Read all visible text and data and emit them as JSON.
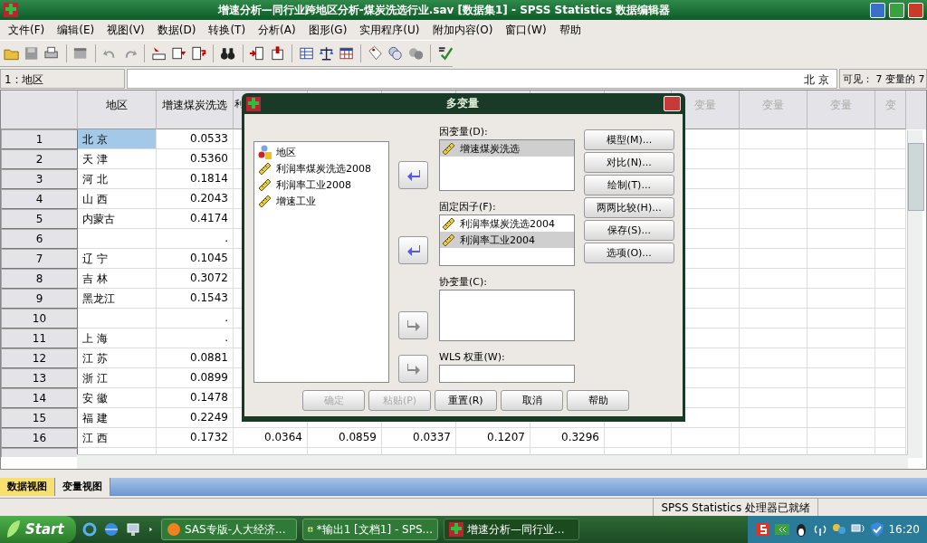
{
  "window": {
    "title": "增速分析—同行业跨地区分析-煤炭洗选行业.sav [数据集1] - SPSS Statistics 数据编辑器"
  },
  "menu": [
    "文件(F)",
    "编辑(E)",
    "视图(V)",
    "数据(D)",
    "转换(T)",
    "分析(A)",
    "图形(G)",
    "实用程序(U)",
    "附加内容(O)",
    "窗口(W)",
    "帮助"
  ],
  "cell_editor": {
    "cell_ref": "1 : 地区",
    "value": "北 京",
    "visible": "可见： 7 变量的 7"
  },
  "columns": [
    {
      "label": "地区",
      "kind": "variable"
    },
    {
      "label": "增速煤炭洗选",
      "kind": "variable"
    },
    {
      "label": "利",
      "kind": "variable"
    },
    {
      "kind": "variable"
    },
    {
      "kind": "variable"
    },
    {
      "kind": "variable"
    },
    {
      "kind": "variable"
    },
    {
      "kind": "empty"
    },
    {
      "label": "变量",
      "kind": "empty"
    },
    {
      "label": "变量",
      "kind": "empty"
    },
    {
      "label": "变量",
      "kind": "empty"
    },
    {
      "label": "变",
      "kind": "empty"
    }
  ],
  "rows": [
    {
      "number": "1",
      "region": "北 京",
      "values": [
        "0.0533"
      ],
      "current": true
    },
    {
      "number": "2",
      "region": "天 津",
      "values": [
        "0.5360"
      ],
      "current": false
    },
    {
      "number": "3",
      "region": "河 北",
      "values": [
        "0.1814"
      ],
      "current": false
    },
    {
      "number": "4",
      "region": "山 西",
      "values": [
        "0.2043"
      ],
      "current": false
    },
    {
      "number": "5",
      "region": "内蒙古",
      "values": [
        "0.4174"
      ],
      "current": false
    },
    {
      "number": "6",
      "values": [
        "."
      ],
      "current": false
    },
    {
      "number": "7",
      "region": "辽 宁",
      "values": [
        "0.1045"
      ],
      "current": false
    },
    {
      "number": "8",
      "region": "吉 林",
      "values": [
        "0.3072"
      ],
      "current": false
    },
    {
      "number": "9",
      "region": "黑龙江",
      "values": [
        "0.1543"
      ],
      "current": false
    },
    {
      "number": "10",
      "values": [
        "."
      ],
      "current": false
    },
    {
      "number": "11",
      "region": "上 海",
      "values": [
        "."
      ],
      "current": false
    },
    {
      "number": "12",
      "region": "江 苏",
      "values": [
        "0.0881"
      ],
      "current": false
    },
    {
      "number": "13",
      "region": "浙 江",
      "values": [
        "0.0899"
      ],
      "current": false
    },
    {
      "number": "14",
      "region": "安 徽",
      "values": [
        "0.1478"
      ],
      "current": false
    },
    {
      "number": "15",
      "region": "福 建",
      "values": [
        "0.2249"
      ],
      "current": false
    },
    {
      "number": "16",
      "region": "江 西",
      "values": [
        "0.1732",
        "0.0364",
        "0.0859",
        "0.0337",
        "0.1207",
        "0.3296"
      ],
      "current": false
    }
  ],
  "dialog": {
    "title": "多变量",
    "source_list": [
      {
        "label": "地区",
        "kind": "nominal"
      },
      {
        "label": "利润率煤炭洗选2008",
        "kind": "scale"
      },
      {
        "label": "利润率工业2008",
        "kind": "scale"
      },
      {
        "label": "增速工业",
        "kind": "scale"
      }
    ],
    "targets": [
      {
        "label": "因变量(D):",
        "kind": "list",
        "disabled": false,
        "items": [
          {
            "label": "增速煤炭洗选",
            "kind": "scale",
            "selected": true
          }
        ]
      },
      {
        "label": "固定因子(F):",
        "kind": "list",
        "disabled": false,
        "items": [
          {
            "label": "利润率煤炭洗选2004",
            "kind": "scale",
            "selected": false
          },
          {
            "label": "利润率工业2004",
            "kind": "scale",
            "selected": true
          }
        ]
      },
      {
        "label": "协变量(C):",
        "kind": "list",
        "disabled": true
      },
      {
        "label": "WLS 权重(W):",
        "kind": "field",
        "disabled": true
      }
    ],
    "side_buttons": [
      "模型(M)...",
      "对比(N)...",
      "绘制(T)...",
      "两两比较(H)...",
      "保存(S)...",
      "选项(O)..."
    ],
    "buttons": [
      {
        "label": "确定",
        "disabled": true
      },
      {
        "label": "粘贴(P)",
        "disabled": true
      },
      {
        "label": "重置(R)",
        "disabled": false
      },
      {
        "label": "取消",
        "disabled": false
      },
      {
        "label": "帮助",
        "disabled": false
      }
    ]
  },
  "view_tabs": [
    {
      "label": "数据视图",
      "selected": true
    },
    {
      "label": "变量视图",
      "selected": false
    }
  ],
  "status_bar": {
    "text": "SPSS Statistics  处理器已就绪"
  },
  "taskbar": {
    "start": "Start",
    "tasks": [
      {
        "label": "SAS专版-人大经济...",
        "kind": "sas",
        "selected": false
      },
      {
        "label": "*输出1 [文档1] - SPS...",
        "kind": "output",
        "selected": false
      },
      {
        "label": "增速分析—同行业...",
        "kind": "data",
        "selected": true
      }
    ],
    "clock": "16:20"
  }
}
